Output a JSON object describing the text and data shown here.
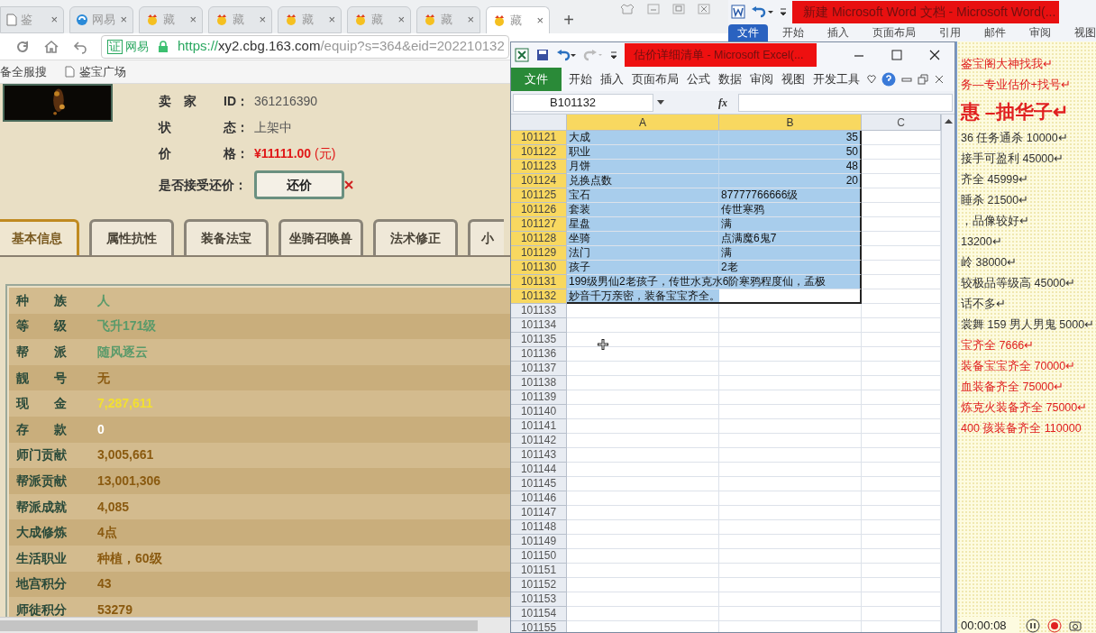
{
  "browser": {
    "tabs": [
      {
        "label": "鉴",
        "kind": "page",
        "close": "×",
        "selected": false
      },
      {
        "label": "网易",
        "kind": "globe",
        "close": "×",
        "selected": false
      },
      {
        "label": "藏",
        "kind": "chick",
        "close": "×",
        "selected": false
      },
      {
        "label": "藏",
        "kind": "chick",
        "close": "×",
        "selected": false
      },
      {
        "label": "藏",
        "kind": "chick",
        "close": "×",
        "selected": false
      },
      {
        "label": "藏",
        "kind": "chick",
        "close": "×",
        "selected": false
      },
      {
        "label": "藏",
        "kind": "chick",
        "close": "×",
        "selected": false
      },
      {
        "label": "藏",
        "kind": "chick",
        "close": "×",
        "selected": true
      }
    ],
    "new_tab": "+",
    "address": {
      "badge": "证",
      "site": "网易",
      "scheme": "https://",
      "host": "xy2.cbg.163.com",
      "path": "/equip?s=364&eid=202210132"
    },
    "bookmarks": [
      "备全服搜",
      "鉴宝广场"
    ],
    "info": [
      {
        "label_1": "卖　家",
        "label_2": "ID：",
        "value": "361216390",
        "kind": "plain"
      },
      {
        "label_1": "状",
        "label_2": "态：",
        "value": "上架中",
        "kind": "plain"
      },
      {
        "label_1": "价",
        "label_2": "格：",
        "value": "¥11111.00",
        "unit": "(元)",
        "kind": "price"
      }
    ],
    "counter_offer": {
      "label": "是否接受还价：",
      "button": "还价"
    },
    "section_tabs": [
      {
        "label": "基本信息",
        "selected": true
      },
      {
        "label": "属性抗性",
        "selected": false
      },
      {
        "label": "装备法宝",
        "selected": false
      },
      {
        "label": "坐骑召唤兽",
        "selected": false
      },
      {
        "label": "法术修正",
        "selected": false
      },
      {
        "label": "小",
        "selected": false
      }
    ],
    "stats": [
      {
        "label": "种　　族",
        "value": "人",
        "color": "#5a9a6a"
      },
      {
        "label": "等　　级",
        "value": "飞升171级",
        "color": "#5a9a6a"
      },
      {
        "label": "帮　　派",
        "value": "随风逐云",
        "color": "#5a9a6a"
      },
      {
        "label": "靓　　号",
        "value": "无",
        "color": "#8a5a10"
      },
      {
        "label": "现　　金",
        "value": "7,287,611",
        "color": "#f2e030"
      },
      {
        "label": "存　　款",
        "value": "0",
        "color": "#ffffff"
      },
      {
        "label": "师门贡献",
        "value": "3,005,661",
        "color": "#8a5a10"
      },
      {
        "label": "帮派贡献",
        "value": "13,001,306",
        "color": "#8a5a10"
      },
      {
        "label": "帮派成就",
        "value": "4,085",
        "color": "#8a5a10"
      },
      {
        "label": "大成修炼",
        "value": "4点",
        "color": "#8a5a10"
      },
      {
        "label": "生活职业",
        "value": "种植，60级",
        "color": "#8a5a10"
      },
      {
        "label": "地宫积分",
        "value": "43",
        "color": "#8a5a10"
      },
      {
        "label": "师徒积分",
        "value": "53279",
        "color": "#8a5a10"
      }
    ]
  },
  "word": {
    "title": "新建 Microsoft Word 文档 - Microsoft Word(...",
    "file_tab": "文件",
    "tabs": [
      "开始",
      "插入",
      "页面布局",
      "引用",
      "邮件",
      "审阅",
      "视图"
    ],
    "lines": [
      {
        "text": "鉴宝阁大神找我↵",
        "kind": "line",
        "color": "#e02020"
      },
      {
        "text": "务—专业估价+找号↵",
        "kind": "line",
        "color": "#e02020"
      },
      {
        "text": "惠 –抽华子↵",
        "kind": "heading",
        "color": "#e02020"
      },
      {
        "text": "36 任务通杀 10000↵",
        "kind": "line",
        "color": "#333333"
      },
      {
        "text": "接手可盈利 45000↵",
        "kind": "line",
        "color": "#333333"
      },
      {
        "text": "齐全 45999↵",
        "kind": "line",
        "color": "#333333"
      },
      {
        "text": "睡杀 21500↵",
        "kind": "line",
        "color": "#333333"
      },
      {
        "text": "，品像较好↵",
        "kind": "line",
        "color": "#333333"
      },
      {
        "text": "13200↵",
        "kind": "line",
        "color": "#333333"
      },
      {
        "text": "岭 38000↵",
        "kind": "line",
        "color": "#333333"
      },
      {
        "text": "较极品等级高 45000↵",
        "kind": "line",
        "color": "#333333"
      },
      {
        "text": "话不多↵",
        "kind": "line",
        "color": "#333333"
      },
      {
        "text": "裳舞 159 男人男鬼 5000↵",
        "kind": "line",
        "color": "#333333"
      },
      {
        "text": "宝齐全 7666↵",
        "kind": "line",
        "color": "#e02020"
      },
      {
        "text": "装备宝宝齐全 70000↵",
        "kind": "line",
        "color": "#e02020"
      },
      {
        "text": "血装备齐全 75000↵",
        "kind": "line",
        "color": "#e02020"
      },
      {
        "text": "炼克火装备齐全 75000↵",
        "kind": "line",
        "color": "#e02020"
      },
      {
        "text": "400 孩装备齐全 110000",
        "kind": "line",
        "color": "#e02020"
      }
    ]
  },
  "excel": {
    "title": "估价详细清单 - Microsoft Excel(...",
    "file_tab": "文件",
    "tabs": [
      "开始",
      "插入",
      "页面布局",
      "公式",
      "数据",
      "审阅",
      "视图",
      "开发工具"
    ],
    "name_box": "B101132",
    "fx": "fx",
    "columns": [
      {
        "label": "A",
        "selected": true
      },
      {
        "label": "B",
        "selected": true
      },
      {
        "label": "C",
        "selected": false
      }
    ],
    "rows": [
      {
        "header": "101121",
        "a": "大成",
        "b": "35",
        "kind": "number",
        "selected": true,
        "active": false
      },
      {
        "header": "101122",
        "a": "职业",
        "b": "50",
        "kind": "number",
        "selected": true,
        "active": false
      },
      {
        "header": "101123",
        "a": "月饼",
        "b": "48",
        "kind": "number",
        "selected": true,
        "active": false
      },
      {
        "header": "101124",
        "a": "兑换点数",
        "b": "20",
        "kind": "number",
        "selected": true,
        "active": false
      },
      {
        "header": "101125",
        "a": "宝石",
        "b": "87777766666级",
        "kind": "text",
        "selected": true,
        "active": false
      },
      {
        "header": "101126",
        "a": "套装",
        "b": "传世寒鸦",
        "kind": "text",
        "selected": true,
        "active": false
      },
      {
        "header": "101127",
        "a": "星盘",
        "b": "满",
        "kind": "text",
        "selected": true,
        "active": false
      },
      {
        "header": "101128",
        "a": "坐骑",
        "b": "点满魔6鬼7",
        "kind": "text",
        "selected": true,
        "active": false
      },
      {
        "header": "101129",
        "a": "法门",
        "b": "满",
        "kind": "text",
        "selected": true,
        "active": false
      },
      {
        "header": "101130",
        "a": "孩子",
        "b": "2老",
        "kind": "text",
        "selected": true,
        "active": false
      },
      {
        "header": "101131",
        "a": "199级男仙2老孩子，传世水克水6阶寒鸦程度仙，孟极",
        "kind": "span",
        "selected": true,
        "active": false
      },
      {
        "header": "101132",
        "a": "妙音千万亲密，装备宝宝齐全。",
        "kind": "span",
        "selected": true,
        "active": true
      },
      {
        "header": "101133"
      },
      {
        "header": "101134"
      },
      {
        "header": "101135"
      },
      {
        "header": "101136"
      },
      {
        "header": "101137"
      },
      {
        "header": "101138"
      },
      {
        "header": "101139"
      },
      {
        "header": "101140"
      },
      {
        "header": "101141"
      },
      {
        "header": "101142"
      },
      {
        "header": "101143"
      },
      {
        "header": "101144"
      },
      {
        "header": "101145"
      },
      {
        "header": "101146"
      },
      {
        "header": "101147"
      },
      {
        "header": "101148"
      },
      {
        "header": "101149"
      },
      {
        "header": "101150"
      },
      {
        "header": "101151"
      },
      {
        "header": "101152"
      },
      {
        "header": "101153"
      },
      {
        "header": "101154"
      },
      {
        "header": "101155"
      }
    ]
  },
  "recorder": {
    "time": "00:00:08"
  }
}
